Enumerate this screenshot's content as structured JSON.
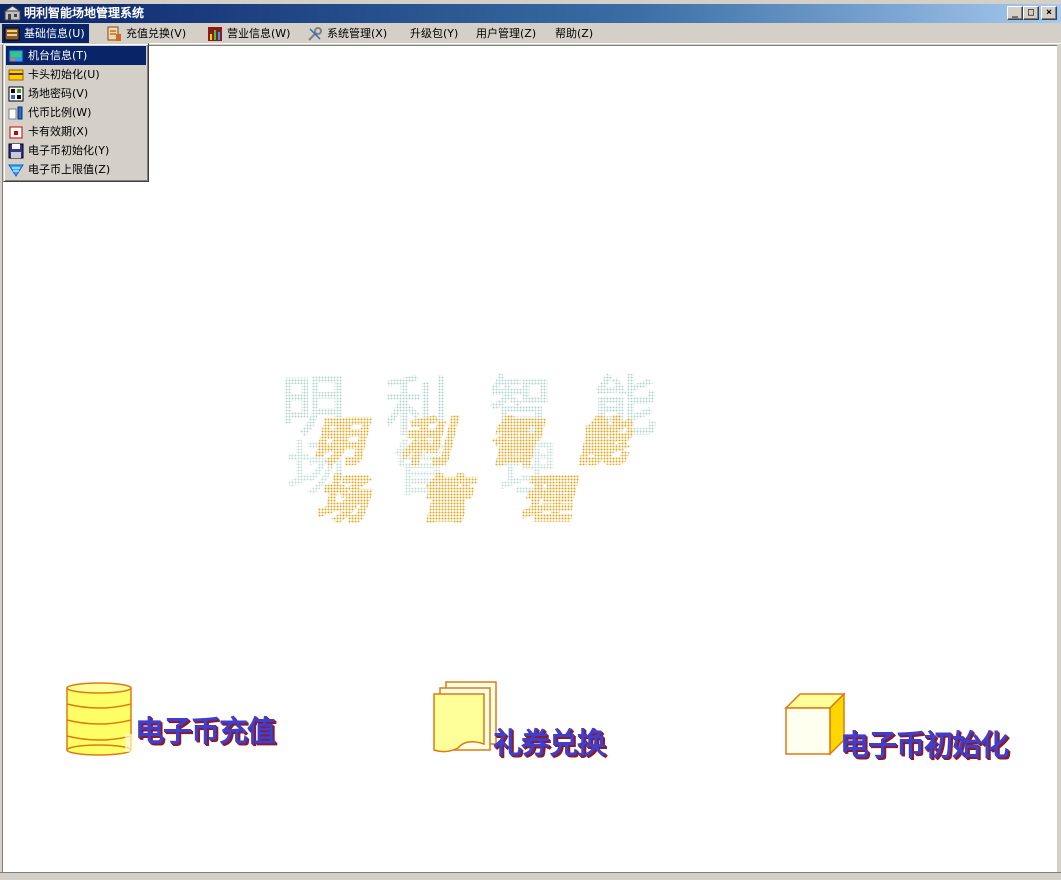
{
  "window": {
    "title": "明利智能场地管理系统",
    "minimize_glyph": "_",
    "maximize_glyph": "□",
    "close_glyph": "×"
  },
  "menubar": {
    "items": [
      {
        "label": "基础信息(U)",
        "icon": "database-icon"
      },
      {
        "label": "充值兑换(V)",
        "icon": "hand-card-icon"
      },
      {
        "label": "营业信息(W)",
        "icon": "bar-chart-icon"
      },
      {
        "label": "系统管理(X)",
        "icon": "tools-icon"
      },
      {
        "label": "升级包(Y)",
        "icon": ""
      },
      {
        "label": "用户管理(Z)",
        "icon": ""
      },
      {
        "label": "帮助(Z)",
        "icon": ""
      }
    ]
  },
  "dropdown": {
    "items": [
      {
        "label": "机台信息(T)",
        "icon": "machine-icon"
      },
      {
        "label": "卡头初始化(U)",
        "icon": "card-reader-icon"
      },
      {
        "label": "场地密码(V)",
        "icon": "password-icon"
      },
      {
        "label": "代币比例(W)",
        "icon": "ratio-icon"
      },
      {
        "label": "卡有效期(X)",
        "icon": "calendar-icon"
      },
      {
        "label": "电子币初始化(Y)",
        "icon": "save-icon"
      },
      {
        "label": "电子币上限值(Z)",
        "icon": "down-arrow-icon"
      }
    ]
  },
  "logo": {
    "top_text": "明利智能",
    "front_text_1": "明利智能",
    "front_text_2": "场管理"
  },
  "features": [
    {
      "label": "电子币充值",
      "icon": "coin-stack-icon"
    },
    {
      "label": "礼券兑换",
      "icon": "coupon-stack-icon"
    },
    {
      "label": "电子币初始化",
      "icon": "cube-icon"
    }
  ],
  "colors": {
    "title_bar": "#0a246a",
    "menu_highlight": "#0a246a",
    "feature_text": "#3d3fd0",
    "feature_shadow": "#8a1b2b",
    "icon_yellow": "#ffff66",
    "logo_orange": "#e8a317",
    "logo_teal": "#b8d8d0"
  }
}
